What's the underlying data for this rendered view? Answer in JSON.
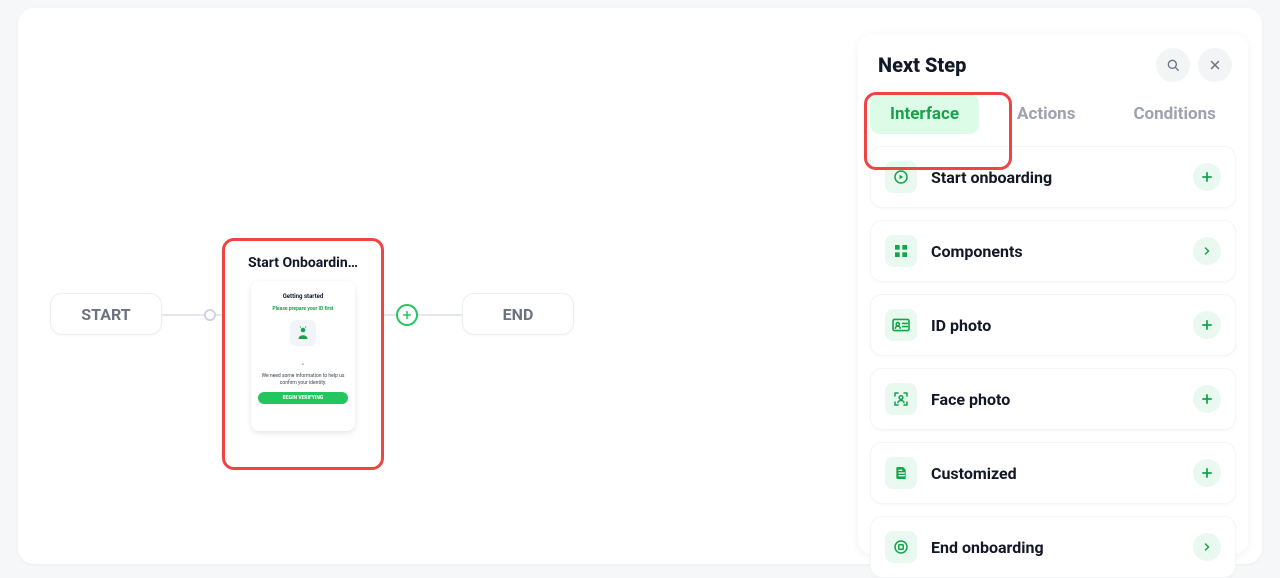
{
  "flow": {
    "start_label": "START",
    "end_label": "END",
    "card_title": "Start Onboardin…",
    "phone": {
      "heading": "Getting started",
      "subheading": "Please prepare your ID first",
      "body": "We need some information to help us confirm your identity.",
      "button": "BEGIN VERIFYING"
    }
  },
  "panel": {
    "title": "Next Step",
    "tabs": [
      {
        "label": "Interface",
        "active": true
      },
      {
        "label": "Actions",
        "active": false
      },
      {
        "label": "Conditions",
        "active": false
      }
    ],
    "items": [
      {
        "id": "start-onboarding",
        "label": "Start onboarding",
        "icon": "play",
        "action": "plus"
      },
      {
        "id": "components",
        "label": "Components",
        "icon": "grid",
        "action": "chevron"
      },
      {
        "id": "id-photo",
        "label": "ID photo",
        "icon": "idcard",
        "action": "plus"
      },
      {
        "id": "face-photo",
        "label": "Face photo",
        "icon": "face",
        "action": "plus"
      },
      {
        "id": "customized",
        "label": "Customized",
        "icon": "doc",
        "action": "plus"
      },
      {
        "id": "end-onboarding",
        "label": "End onboarding",
        "icon": "stop",
        "action": "chevron"
      }
    ]
  },
  "icons": {
    "search": "search-icon",
    "close": "close-icon"
  },
  "colors": {
    "accent": "#22c55e",
    "highlight": "#ef4444"
  }
}
